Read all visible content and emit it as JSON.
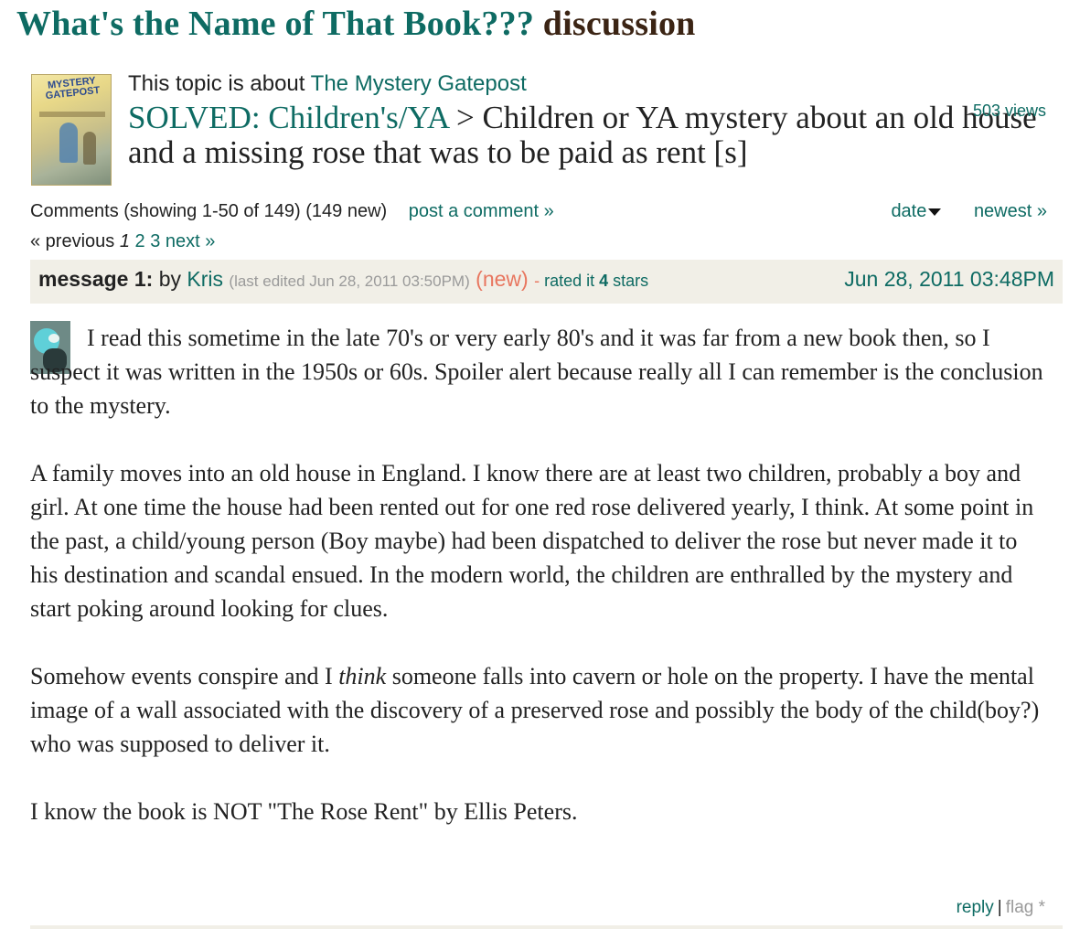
{
  "group": {
    "name": "What's the Name of That Book???",
    "suffix": "discussion"
  },
  "cover": {
    "title_line1": "MYSTERY",
    "title_line2": "GATEPOST"
  },
  "topic": {
    "about_prefix": "This topic is about",
    "book_title": "The Mystery Gatepost",
    "folder": "SOLVED: Children's/YA",
    "arrow": ">",
    "title": "Children or YA mystery about an old house and a missing rose that was to be paid as rent [s]",
    "views": "503 views"
  },
  "comments_bar": {
    "summary": "Comments (showing 1-50 of 149) (149 new)",
    "post_link": "post a comment »",
    "sort_label": "date",
    "newest_link": "newest »"
  },
  "pager": {
    "previous": "« previous",
    "current": "1",
    "page2": "2",
    "page3": "3",
    "next": "next »"
  },
  "message": {
    "label": "message 1:",
    "by": "by",
    "author": "Kris",
    "edited": "(last edited Jun 28, 2011 03:50PM)",
    "new": "(new)",
    "rated_prefix": "-",
    "rated_text": "rated it",
    "rating": "4",
    "rated_suffix": "stars",
    "date": "Jun 28, 2011 03:48PM",
    "paragraphs": [
      "I read this sometime in the late 70's or very early 80's and it was far from a new book then, so I suspect it was written in the 1950s or 60s. Spoiler alert because really all I can remember is the conclusion to the mystery.",
      "A family moves into an old house in England. I know there are at least two children, probably a boy and girl. At one time the house had been rented out for one red rose delivered yearly, I think. At some point in the past, a child/young person (Boy maybe) had been dispatched to deliver the rose but never made it to his destination and scandal ensued. In the modern world, the children are enthralled by the mystery and start poking around looking for clues.",
      "I know the book is NOT \"The Rose Rent\" by Ellis Peters."
    ],
    "p3_before": "Somehow events conspire and I",
    "p3_emph": "think",
    "p3_after": "someone falls into cavern or hole on the property. I have the mental image of a wall associated with the discovery of a preserved rose and possibly the body of the child(boy?) who was supposed to deliver it.",
    "reply": "reply",
    "sep": "|",
    "flag": "flag *"
  },
  "colors": {
    "link": "#0e6b63",
    "group_suffix": "#3b2414",
    "new_badge": "#e8765f",
    "header_bg": "#f1efe7",
    "muted": "#9a9a9a"
  }
}
